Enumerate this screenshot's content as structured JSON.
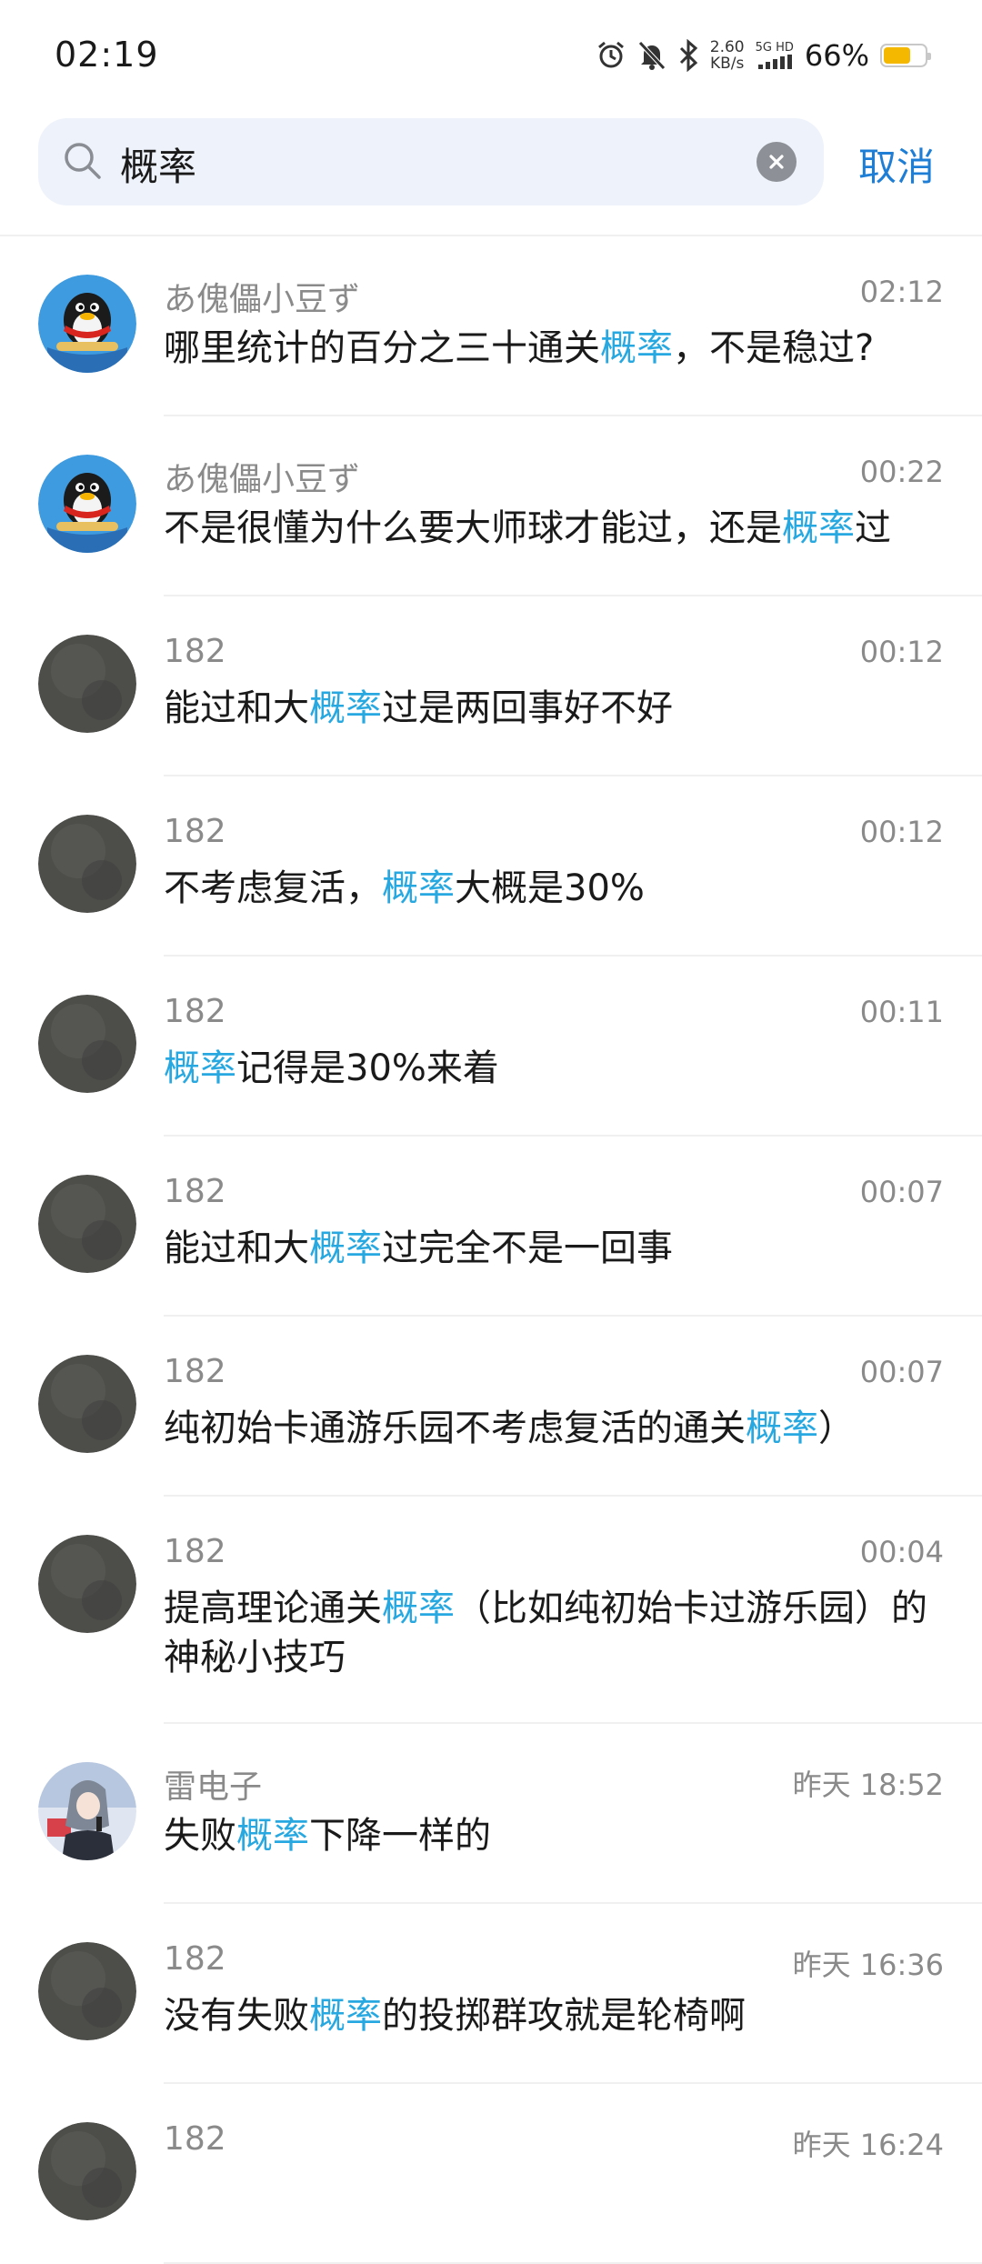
{
  "status_bar": {
    "time": "02:19",
    "net_speed_value": "2.60",
    "net_speed_unit": "KB/s",
    "network_type": "5G HD",
    "battery_percent": "66%",
    "battery_level": 0.66,
    "icons": [
      "alarm-icon",
      "mute-bell-icon",
      "bluetooth-icon",
      "signal-icon",
      "battery-icon"
    ]
  },
  "search": {
    "query": "概率",
    "cancel_label": "取消"
  },
  "highlight_color": "#28a8e0",
  "results": [
    {
      "name": "あ傀儡小豆ず",
      "time": "02:12",
      "avatar": "penguin",
      "msg_before": "哪里统计的百分之三十通关",
      "msg_hl": "概率",
      "msg_after": "，不是稳过?"
    },
    {
      "name": "あ傀儡小豆ず",
      "time": "00:22",
      "avatar": "penguin",
      "msg_before": "不是很懂为什么要大师球才能过，还是",
      "msg_hl": "概率",
      "msg_after": "过"
    },
    {
      "name": "182",
      "time": "00:12",
      "avatar": "gray",
      "msg_before": "能过和大",
      "msg_hl": "概率",
      "msg_after": "过是两回事好不好"
    },
    {
      "name": "182",
      "time": "00:12",
      "avatar": "gray",
      "msg_before": "不考虑复活，",
      "msg_hl": "概率",
      "msg_after": "大概是30%"
    },
    {
      "name": "182",
      "time": "00:11",
      "avatar": "gray",
      "msg_before": "",
      "msg_hl": "概率",
      "msg_after": "记得是30%来着"
    },
    {
      "name": "182",
      "time": "00:07",
      "avatar": "gray",
      "msg_before": "能过和大",
      "msg_hl": "概率",
      "msg_after": "过完全不是一回事"
    },
    {
      "name": "182",
      "time": "00:07",
      "avatar": "gray",
      "msg_before": "纯初始卡通游乐园不考虑复活的通关",
      "msg_hl": "概率",
      "msg_after": "）"
    },
    {
      "name": "182",
      "time": "00:04",
      "avatar": "gray",
      "msg_before": "提高理论通关",
      "msg_hl": "概率",
      "msg_after": "（比如纯初始卡过游乐园）的神秘小技巧"
    },
    {
      "name": "雷电子",
      "time": "昨天 18:52",
      "avatar": "anime",
      "msg_before": "失败",
      "msg_hl": "概率",
      "msg_after": "下降一样的"
    },
    {
      "name": "182",
      "time": "昨天 16:36",
      "avatar": "gray",
      "msg_before": "没有失败",
      "msg_hl": "概率",
      "msg_after": "的投掷群攻就是轮椅啊"
    },
    {
      "name": "182",
      "time": "昨天 16:24",
      "avatar": "gray",
      "msg_before": "",
      "msg_hl": "",
      "msg_after": ""
    }
  ]
}
